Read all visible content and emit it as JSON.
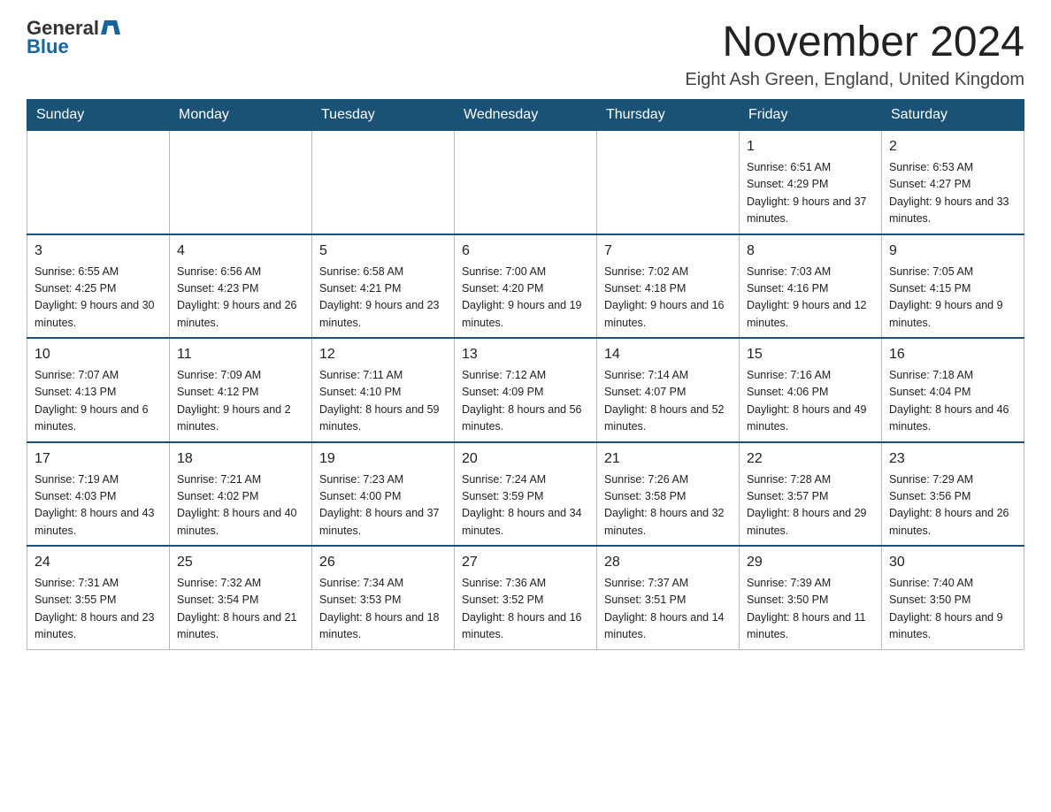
{
  "logo": {
    "general": "General",
    "blue": "Blue"
  },
  "title": "November 2024",
  "location": "Eight Ash Green, England, United Kingdom",
  "weekdays": [
    "Sunday",
    "Monday",
    "Tuesday",
    "Wednesday",
    "Thursday",
    "Friday",
    "Saturday"
  ],
  "weeks": [
    [
      {
        "day": "",
        "info": ""
      },
      {
        "day": "",
        "info": ""
      },
      {
        "day": "",
        "info": ""
      },
      {
        "day": "",
        "info": ""
      },
      {
        "day": "",
        "info": ""
      },
      {
        "day": "1",
        "info": "Sunrise: 6:51 AM\nSunset: 4:29 PM\nDaylight: 9 hours and 37 minutes."
      },
      {
        "day": "2",
        "info": "Sunrise: 6:53 AM\nSunset: 4:27 PM\nDaylight: 9 hours and 33 minutes."
      }
    ],
    [
      {
        "day": "3",
        "info": "Sunrise: 6:55 AM\nSunset: 4:25 PM\nDaylight: 9 hours and 30 minutes."
      },
      {
        "day": "4",
        "info": "Sunrise: 6:56 AM\nSunset: 4:23 PM\nDaylight: 9 hours and 26 minutes."
      },
      {
        "day": "5",
        "info": "Sunrise: 6:58 AM\nSunset: 4:21 PM\nDaylight: 9 hours and 23 minutes."
      },
      {
        "day": "6",
        "info": "Sunrise: 7:00 AM\nSunset: 4:20 PM\nDaylight: 9 hours and 19 minutes."
      },
      {
        "day": "7",
        "info": "Sunrise: 7:02 AM\nSunset: 4:18 PM\nDaylight: 9 hours and 16 minutes."
      },
      {
        "day": "8",
        "info": "Sunrise: 7:03 AM\nSunset: 4:16 PM\nDaylight: 9 hours and 12 minutes."
      },
      {
        "day": "9",
        "info": "Sunrise: 7:05 AM\nSunset: 4:15 PM\nDaylight: 9 hours and 9 minutes."
      }
    ],
    [
      {
        "day": "10",
        "info": "Sunrise: 7:07 AM\nSunset: 4:13 PM\nDaylight: 9 hours and 6 minutes."
      },
      {
        "day": "11",
        "info": "Sunrise: 7:09 AM\nSunset: 4:12 PM\nDaylight: 9 hours and 2 minutes."
      },
      {
        "day": "12",
        "info": "Sunrise: 7:11 AM\nSunset: 4:10 PM\nDaylight: 8 hours and 59 minutes."
      },
      {
        "day": "13",
        "info": "Sunrise: 7:12 AM\nSunset: 4:09 PM\nDaylight: 8 hours and 56 minutes."
      },
      {
        "day": "14",
        "info": "Sunrise: 7:14 AM\nSunset: 4:07 PM\nDaylight: 8 hours and 52 minutes."
      },
      {
        "day": "15",
        "info": "Sunrise: 7:16 AM\nSunset: 4:06 PM\nDaylight: 8 hours and 49 minutes."
      },
      {
        "day": "16",
        "info": "Sunrise: 7:18 AM\nSunset: 4:04 PM\nDaylight: 8 hours and 46 minutes."
      }
    ],
    [
      {
        "day": "17",
        "info": "Sunrise: 7:19 AM\nSunset: 4:03 PM\nDaylight: 8 hours and 43 minutes."
      },
      {
        "day": "18",
        "info": "Sunrise: 7:21 AM\nSunset: 4:02 PM\nDaylight: 8 hours and 40 minutes."
      },
      {
        "day": "19",
        "info": "Sunrise: 7:23 AM\nSunset: 4:00 PM\nDaylight: 8 hours and 37 minutes."
      },
      {
        "day": "20",
        "info": "Sunrise: 7:24 AM\nSunset: 3:59 PM\nDaylight: 8 hours and 34 minutes."
      },
      {
        "day": "21",
        "info": "Sunrise: 7:26 AM\nSunset: 3:58 PM\nDaylight: 8 hours and 32 minutes."
      },
      {
        "day": "22",
        "info": "Sunrise: 7:28 AM\nSunset: 3:57 PM\nDaylight: 8 hours and 29 minutes."
      },
      {
        "day": "23",
        "info": "Sunrise: 7:29 AM\nSunset: 3:56 PM\nDaylight: 8 hours and 26 minutes."
      }
    ],
    [
      {
        "day": "24",
        "info": "Sunrise: 7:31 AM\nSunset: 3:55 PM\nDaylight: 8 hours and 23 minutes."
      },
      {
        "day": "25",
        "info": "Sunrise: 7:32 AM\nSunset: 3:54 PM\nDaylight: 8 hours and 21 minutes."
      },
      {
        "day": "26",
        "info": "Sunrise: 7:34 AM\nSunset: 3:53 PM\nDaylight: 8 hours and 18 minutes."
      },
      {
        "day": "27",
        "info": "Sunrise: 7:36 AM\nSunset: 3:52 PM\nDaylight: 8 hours and 16 minutes."
      },
      {
        "day": "28",
        "info": "Sunrise: 7:37 AM\nSunset: 3:51 PM\nDaylight: 8 hours and 14 minutes."
      },
      {
        "day": "29",
        "info": "Sunrise: 7:39 AM\nSunset: 3:50 PM\nDaylight: 8 hours and 11 minutes."
      },
      {
        "day": "30",
        "info": "Sunrise: 7:40 AM\nSunset: 3:50 PM\nDaylight: 8 hours and 9 minutes."
      }
    ]
  ]
}
